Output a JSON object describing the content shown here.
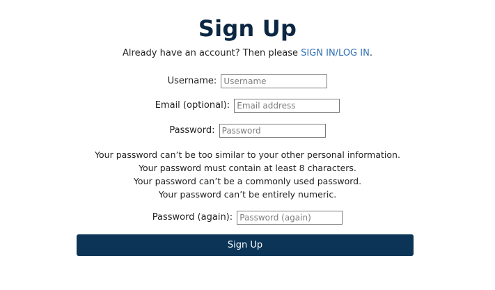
{
  "page": {
    "title": "Sign Up"
  },
  "login_prompt": {
    "text": "Already have an account? Then please ",
    "link_text": "SIGN IN/LOG IN",
    "suffix": "."
  },
  "fields": {
    "username": {
      "label": "Username:",
      "placeholder": "Username",
      "value": ""
    },
    "email": {
      "label": "Email (optional):",
      "placeholder": "Email address",
      "value": ""
    },
    "password": {
      "label": "Password:",
      "placeholder": "Password",
      "value": ""
    },
    "password2": {
      "label": "Password (again):",
      "placeholder": "Password (again)",
      "value": ""
    }
  },
  "password_help": [
    "Your password can’t be too similar to your other personal information.",
    "Your password must contain at least 8 characters.",
    "Your password can’t be a commonly used password.",
    "Your password can’t be entirely numeric."
  ],
  "submit": {
    "label": "Sign Up"
  },
  "colors": {
    "title": "#0b2742",
    "link": "#2e6fb7",
    "button_bg": "#0b3456",
    "button_text": "#ffffff"
  }
}
